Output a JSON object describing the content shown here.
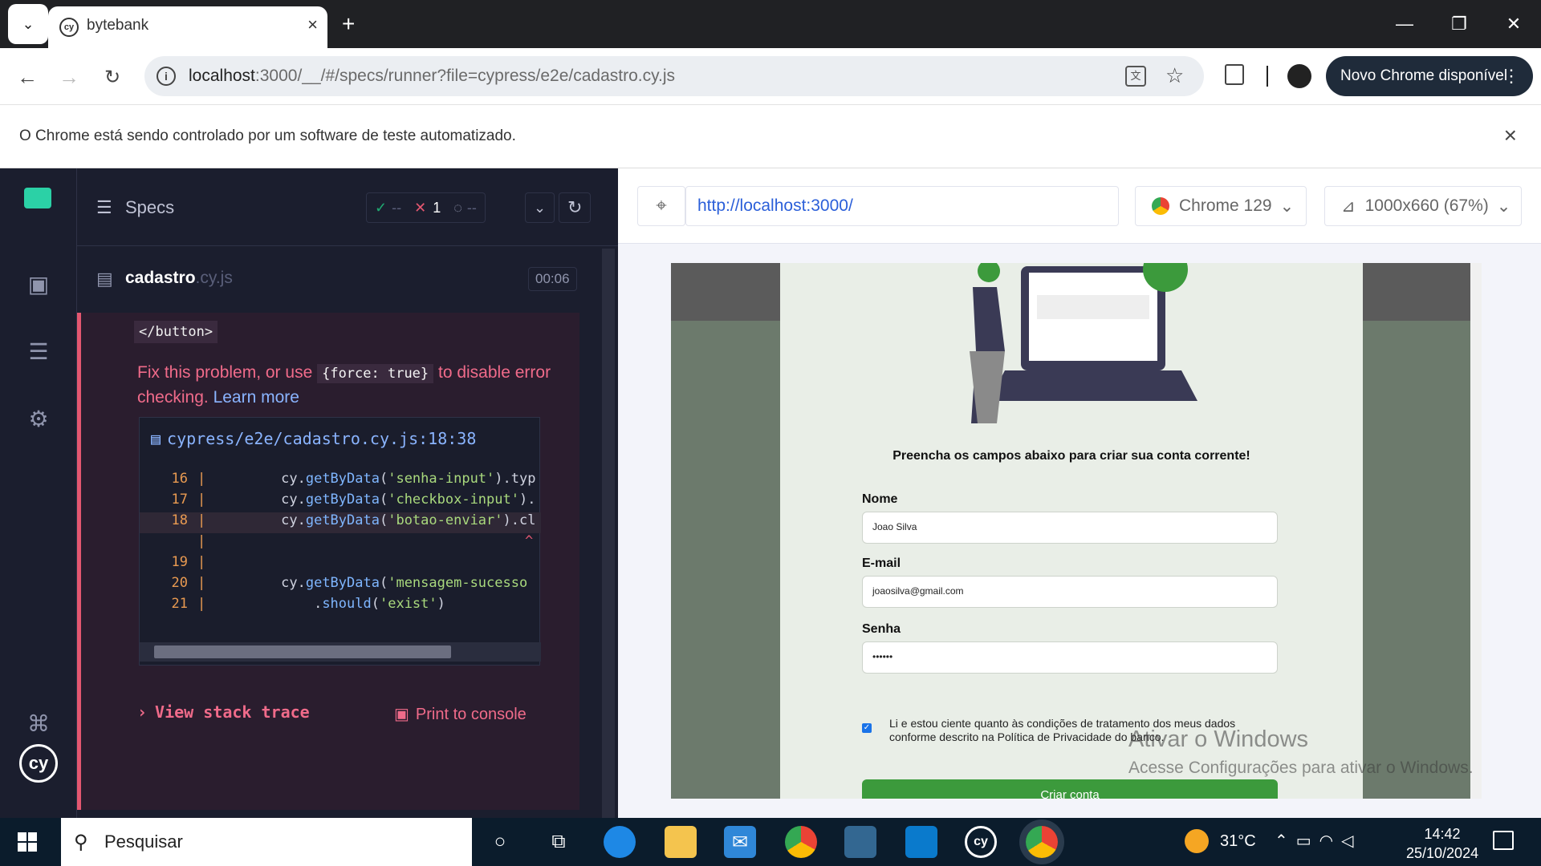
{
  "browser": {
    "tab_title": "bytebank",
    "url_host": "localhost",
    "url_rest": ":3000/__/#/specs/runner?file=cypress/e2e/cadastro.cy.js",
    "new_chrome": "Novo Chrome disponível",
    "automation_notice": "O Chrome está sendo controlado por um software de teste automatizado."
  },
  "reporter": {
    "specs_label": "Specs",
    "passed": "--",
    "failed": "1",
    "pending": "--",
    "spec_name": "cadastro",
    "spec_ext": ".cy.js",
    "spec_time": "00:06",
    "error_snippet": "</button>",
    "fix_before": "Fix this problem, or use ",
    "fix_code": "{force: true}",
    "fix_after": " to disable error checking. ",
    "learn_more": "Learn more",
    "code_file": "cypress/e2e/cadastro.cy.js:18:38",
    "code_lines": [
      {
        "n": "16",
        "pre": "        cy.",
        "fn": "getByData",
        "str": "'senha-input'",
        "post": ").typ"
      },
      {
        "n": "17",
        "pre": "        cy.",
        "fn": "getByData",
        "str": "'checkbox-input'",
        "post": ")."
      },
      {
        "n": "18",
        "pre": "        cy.",
        "fn": "getByData",
        "str": "'botao-enviar'",
        "post": ").cl"
      },
      {
        "n": "19",
        "pre": "",
        "fn": "",
        "str": "",
        "post": ""
      },
      {
        "n": "20",
        "pre": "        cy.",
        "fn": "getByData",
        "str": "'mensagem-sucesso",
        "post": ""
      },
      {
        "n": "21",
        "pre": "            .",
        "fn": "should",
        "str": "'exist'",
        "post": ")"
      }
    ],
    "view_stack": "View stack trace",
    "print_console": "Print to console"
  },
  "aut": {
    "url": "http://localhost:3000/",
    "browser": "Chrome 129",
    "viewport": "1000x660",
    "zoom": "(67%)"
  },
  "form": {
    "heading": "Preencha os campos abaixo para criar sua conta corrente!",
    "name_label": "Nome",
    "name_value": "Joao Silva",
    "email_label": "E-mail",
    "email_value": "joaosilva@gmail.com",
    "password_label": "Senha",
    "password_value": "••••••",
    "terms": "Li e estou ciente quanto às condições de tratamento dos meus dados conforme descrito na Política de Privacidade do banco.",
    "submit": "Criar conta"
  },
  "windows": {
    "watermark1": "Ativar o Windows",
    "watermark2": "Acesse Configurações para ativar o Windows.",
    "search": "Pesquisar",
    "temp": "31°C",
    "time": "14:42",
    "date": "25/10/2024"
  }
}
